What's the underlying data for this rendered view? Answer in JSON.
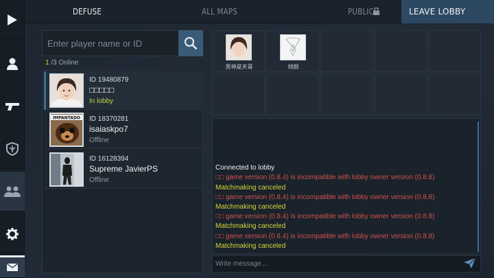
{
  "rail": {
    "items": [
      {
        "icon": "play-icon"
      },
      {
        "icon": "profile-icon"
      },
      {
        "icon": "pistol-icon"
      },
      {
        "icon": "shield-icon"
      },
      {
        "icon": "group-icon"
      },
      {
        "icon": "gear-icon"
      },
      {
        "icon": "mail-icon"
      }
    ]
  },
  "topbar": {
    "defuse": "DEFUSE",
    "all_maps": "ALL MAPS",
    "public": "PUBLIC",
    "leave": "LEAVE LOBBY"
  },
  "search": {
    "placeholder": "Enter player name or ID"
  },
  "online": {
    "count": "1",
    "total": "/3 Online"
  },
  "players": [
    {
      "id": "ID 19480879",
      "name": "□□□□□",
      "status": "In lobby"
    },
    {
      "id": "ID 18370281",
      "name": "isaiaskpo7",
      "status": "Offline",
      "avatar_caption": "IMPANTADO"
    },
    {
      "id": "ID 16128394",
      "name": "Supreme JavierPS",
      "status": "Offline"
    }
  ],
  "lobby": {
    "members": [
      {
        "name": "男神是天哥"
      },
      {
        "name": "倾颜"
      }
    ]
  },
  "chat": {
    "lines": [
      {
        "text": "Connected to lobby",
        "color": "white"
      },
      {
        "text": "game version (0.8.4) is incompatible with lobby owner version (0.8.8)",
        "color": "red",
        "prefix": "□□"
      },
      {
        "text": "Matchmaking canceled",
        "color": "yellow"
      },
      {
        "text": "game version (0.8.4) is incompatible with lobby owner version (0.8.8)",
        "color": "red",
        "prefix": "□□"
      },
      {
        "text": "Matchmaking canceled",
        "color": "yellow"
      },
      {
        "text": "game version (0.8.4) is incompatible with lobby owner version (0.8.8)",
        "color": "red",
        "prefix": "□□"
      },
      {
        "text": "Matchmaking canceled",
        "color": "yellow"
      },
      {
        "text": "game version (0.8.4) is incompatible with lobby owner version (0.8.8)",
        "color": "red",
        "prefix": "□□"
      },
      {
        "text": "Matchmaking canceled",
        "color": "yellow"
      }
    ],
    "input_placeholder": "Write message..."
  },
  "colors": {
    "accent": "#3a5b78",
    "leave_bg": "#2d4862",
    "status_lobby": "#c7d23c",
    "error": "#d0524a",
    "notice": "#d6d83a"
  }
}
